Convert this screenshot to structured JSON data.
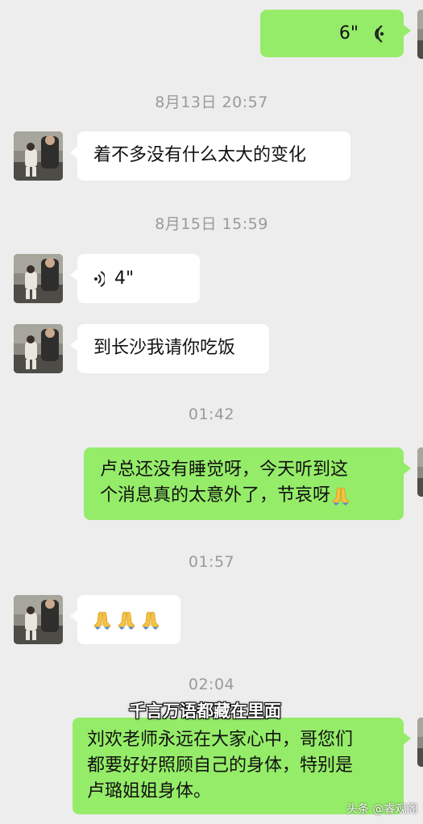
{
  "messages": {
    "m1": {
      "duration": "6\""
    },
    "ts1": "8月13日 20:57",
    "m2": {
      "text": "着不多没有什么太大的变化"
    },
    "ts2": "8月15日 15:59",
    "m3": {
      "duration": "4\""
    },
    "m4": {
      "text": "到长沙我请你吃饭"
    },
    "ts3": "01:42",
    "m5": {
      "line1": "卢总还没有睡觉呀，今天听到这",
      "line2": "个消息真的太意外了，节哀呀"
    },
    "ts4": "01:57",
    "m6": {
      "emoji_count": 3
    },
    "ts5": "02:04",
    "m7": {
      "line1": "刘欢老师永远在大家心中，哥您们",
      "line2": "都要好好照顾自己的身体，特别是",
      "line3": "卢璐姐姐身体。"
    }
  },
  "overlay": {
    "caption": "千言万语都藏在里面",
    "watermark": "头条 @睿观阁"
  },
  "colors": {
    "background": "#ededed",
    "bubble_self": "#95ec69",
    "bubble_other": "#ffffff",
    "timestamp": "#9a9a9a"
  }
}
